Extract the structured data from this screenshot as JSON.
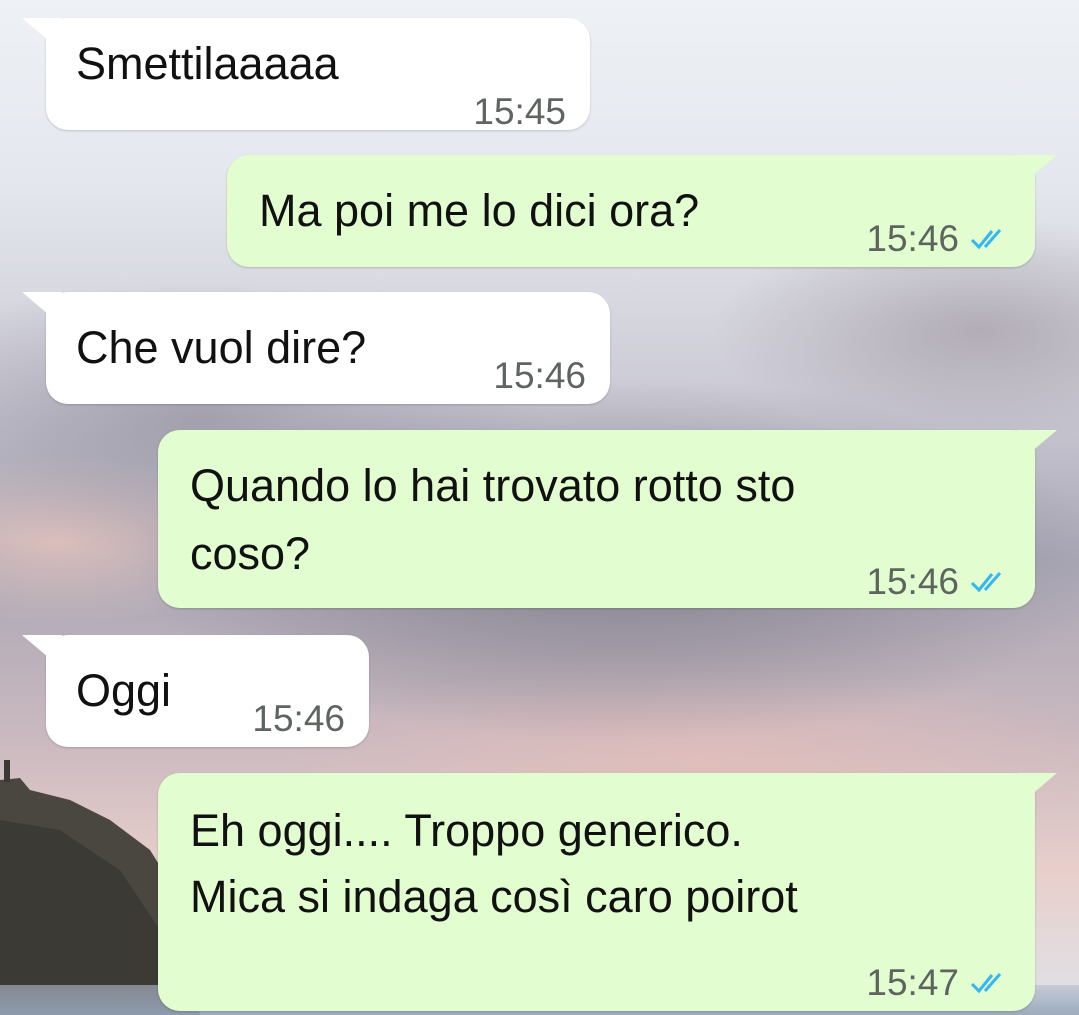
{
  "messages": [
    {
      "direction": "incoming",
      "text": "Smettilaaaaa",
      "time": "15:45"
    },
    {
      "direction": "outgoing",
      "text": "Ma poi me lo dici ora?",
      "time": "15:46",
      "status": "read"
    },
    {
      "direction": "incoming",
      "text": "Che vuol dire?",
      "time": "15:46"
    },
    {
      "direction": "outgoing",
      "lines": [
        "Quando lo hai trovato rotto sto",
        "coso?"
      ],
      "time": "15:46",
      "status": "read"
    },
    {
      "direction": "incoming",
      "text": "Oggi",
      "time": "15:46"
    },
    {
      "direction": "outgoing",
      "lines": [
        "Eh oggi.... Troppo generico.",
        "Mica si indaga così caro poirot"
      ],
      "time": "15:47",
      "status": "read"
    }
  ],
  "colors": {
    "incoming_bubble": "#ffffff",
    "outgoing_bubble": "#e2fdd0",
    "read_ticks": "#34b7f1",
    "timestamp": "#5e6460"
  },
  "icons": {
    "read_receipt": "double-check-icon"
  },
  "background": "sunset-clouds-wallpaper"
}
